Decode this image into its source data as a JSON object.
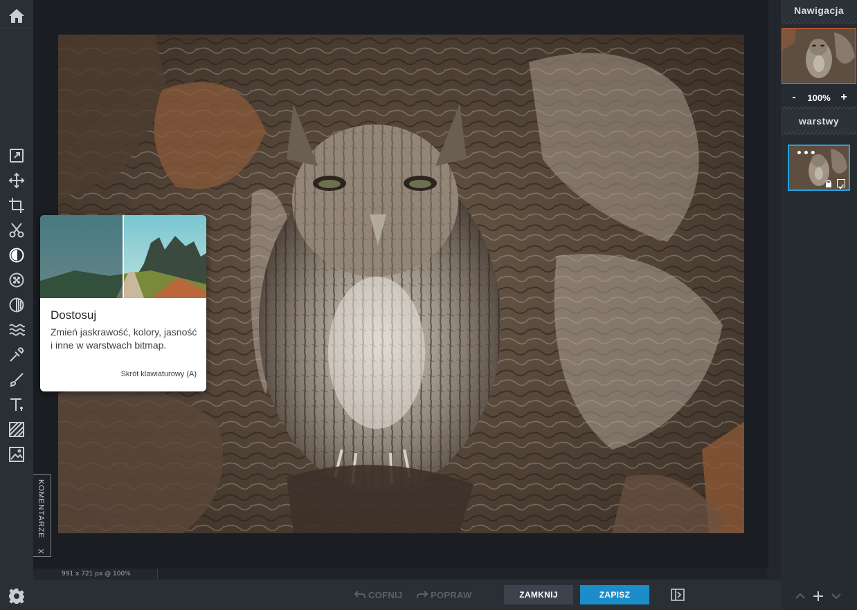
{
  "tools": [
    {
      "name": "home",
      "icon": "home-icon"
    },
    {
      "name": "export",
      "icon": "export-icon"
    },
    {
      "name": "move",
      "icon": "move-icon"
    },
    {
      "name": "crop",
      "icon": "crop-icon"
    },
    {
      "name": "cut",
      "icon": "scissors-icon"
    },
    {
      "name": "adjust",
      "icon": "adjust-icon",
      "active": true
    },
    {
      "name": "effects",
      "icon": "effects-icon"
    },
    {
      "name": "filters",
      "icon": "filter-icon"
    },
    {
      "name": "liquify",
      "icon": "liquify-icon"
    },
    {
      "name": "retouch",
      "icon": "pipette-icon"
    },
    {
      "name": "draw",
      "icon": "brush-icon"
    },
    {
      "name": "text",
      "icon": "text-icon"
    },
    {
      "name": "frames",
      "icon": "frame-icon"
    },
    {
      "name": "image",
      "icon": "image-icon"
    },
    {
      "name": "settings",
      "icon": "gear-icon"
    }
  ],
  "canvas": {
    "status": "991 x 721 px @ 100%"
  },
  "tooltip": {
    "title": "Dostosuj",
    "description": "Zmień jaskrawość, kolory, jasność i inne w warstwach bitmap.",
    "shortcut": "Skrót klawiaturowy (A)"
  },
  "comments": {
    "label": "KOMENTARZE",
    "close": "X"
  },
  "bottom": {
    "undo_label": "COFNIJ",
    "redo_label": "POPRAW",
    "close_label": "ZAMKNIJ",
    "save_label": "ZAPISZ"
  },
  "right_panel": {
    "navigation_title": "Nawigacja",
    "zoom_out": "-",
    "zoom_value": "100%",
    "zoom_in": "+",
    "layers_title": "warstwy",
    "layer_menu": "•••"
  },
  "colors": {
    "accent": "#1b8dc8",
    "selection": "#23a3e0",
    "nav_frame": "#e06a3a"
  }
}
